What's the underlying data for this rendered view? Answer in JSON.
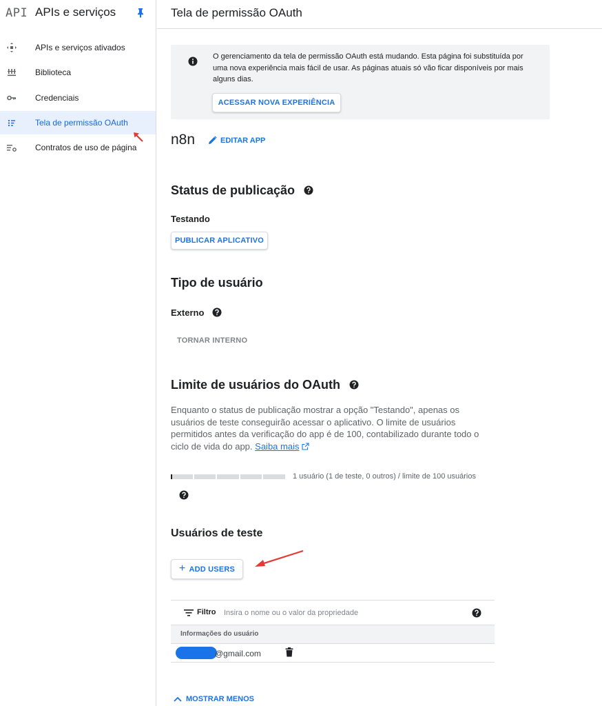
{
  "sidebar": {
    "api_badge": "API",
    "title": "APIs e serviços",
    "items": [
      {
        "label": "APIs e serviços ativados",
        "icon": "diamond-arrows-icon"
      },
      {
        "label": "Biblioteca",
        "icon": "library-icon"
      },
      {
        "label": "Credenciais",
        "icon": "key-icon"
      },
      {
        "label": "Tela de permissão OAuth",
        "icon": "consent-screen-icon",
        "active": true
      },
      {
        "label": "Contratos de uso de página",
        "icon": "settings-list-icon"
      }
    ]
  },
  "header": {
    "title": "Tela de permissão OAuth"
  },
  "banner": {
    "text": "O gerenciamento da tela de permissão OAuth está mudando. Esta página foi substituída por uma nova experiência mais fácil de usar. As páginas atuais só vão ficar disponíveis por mais alguns dias.",
    "button": "ACESSAR NOVA EXPERIÊNCIA"
  },
  "app": {
    "name": "n8n",
    "edit_label": "EDITAR APP"
  },
  "publishing": {
    "heading": "Status de publicação",
    "status": "Testando",
    "button": "PUBLICAR APLICATIVO"
  },
  "user_type": {
    "heading": "Tipo de usuário",
    "value": "Externo",
    "button": "TORNAR INTERNO"
  },
  "user_cap": {
    "heading": "Limite de usuários do OAuth",
    "paragraph": "Enquanto o status de publicação mostrar a opção \"Testando\", apenas os usuários de teste conseguirão acessar o aplicativo. O limite de usuários permitidos antes da verificação do app é de 100, contabilizado durante todo o ciclo de vida do app.",
    "learn_more": "Saiba mais",
    "progress_fraction": 0.01,
    "progress_label": "1 usuário (1 de teste, 0 outros) / limite de 100 usuários"
  },
  "test_users": {
    "heading": "Usuários de teste",
    "add_button": "ADD USERS",
    "filter_label": "Filtro",
    "filter_placeholder": "Insira o nome ou o valor da propriedade",
    "column_header": "Informações do usuário",
    "rows": [
      {
        "email": "@gmail.com"
      }
    ],
    "show_less": "MOSTRAR MENOS"
  },
  "colors": {
    "accent": "#1a73e8",
    "annotation": "#e53935"
  }
}
